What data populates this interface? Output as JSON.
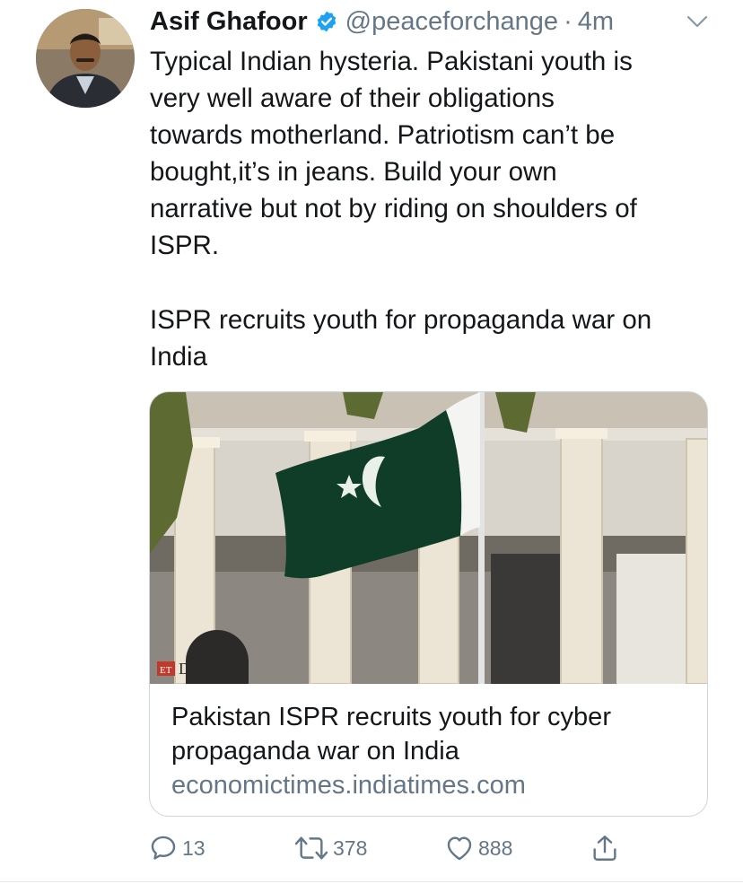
{
  "tweet": {
    "author_name": "Asif Ghafoor",
    "handle": "@peaceforchange",
    "separator": "·",
    "time": "4m",
    "body_part1": "Typical Indian hysteria. Pakistani youth is\nvery well aware of their obligations\ntowards motherland. Patriotism can’t be\nbought,it’s in jeans. Build your own\nnarrative but not by riding on shoulders of\nISPR.",
    "body_part2": "ISPR recruits youth for propaganda war on\nIndia",
    "verified_icon": "verified-badge-icon",
    "menu_icon": "chevron-down-icon"
  },
  "card": {
    "image_watermark_brand": "ET",
    "image_watermark_text": "Defence",
    "title": "Pakistan ISPR recruits youth for cyber\npropaganda war on India",
    "domain": "economictimes.indiatimes.com"
  },
  "actions": {
    "reply_count": "13",
    "retweet_count": "378",
    "like_count": "888",
    "icons": [
      "reply-icon",
      "retweet-icon",
      "like-icon",
      "share-icon"
    ]
  },
  "colors": {
    "text": "#14171a",
    "secondary": "#657786",
    "verified": "#1da1f2",
    "border": "#ccd6dd"
  }
}
